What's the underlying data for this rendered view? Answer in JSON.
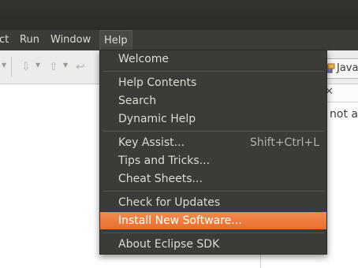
{
  "menubar": {
    "items": [
      "ct",
      "Run",
      "Window",
      "Help"
    ],
    "active_index": 3
  },
  "java_tab": {
    "label": "Java"
  },
  "right_pane": {
    "partial_text": "not av"
  },
  "help_menu": {
    "groups": [
      [
        {
          "label": "Welcome",
          "accel": ""
        }
      ],
      [
        {
          "label": "Help Contents",
          "accel": ""
        },
        {
          "label": "Search",
          "accel": ""
        },
        {
          "label": "Dynamic Help",
          "accel": ""
        }
      ],
      [
        {
          "label": "Key Assist...",
          "accel": "Shift+Ctrl+L"
        },
        {
          "label": "Tips and Tricks...",
          "accel": ""
        },
        {
          "label": "Cheat Sheets...",
          "accel": ""
        }
      ],
      [
        {
          "label": "Check for Updates",
          "accel": ""
        },
        {
          "label": "Install New Software...",
          "accel": "",
          "highlighted": true
        }
      ],
      [
        {
          "label": "About Eclipse SDK",
          "accel": ""
        }
      ]
    ]
  },
  "colors": {
    "menu_bg": "#3c3b37",
    "menu_text": "#dfdbd2",
    "highlight": "#e86f2e"
  }
}
